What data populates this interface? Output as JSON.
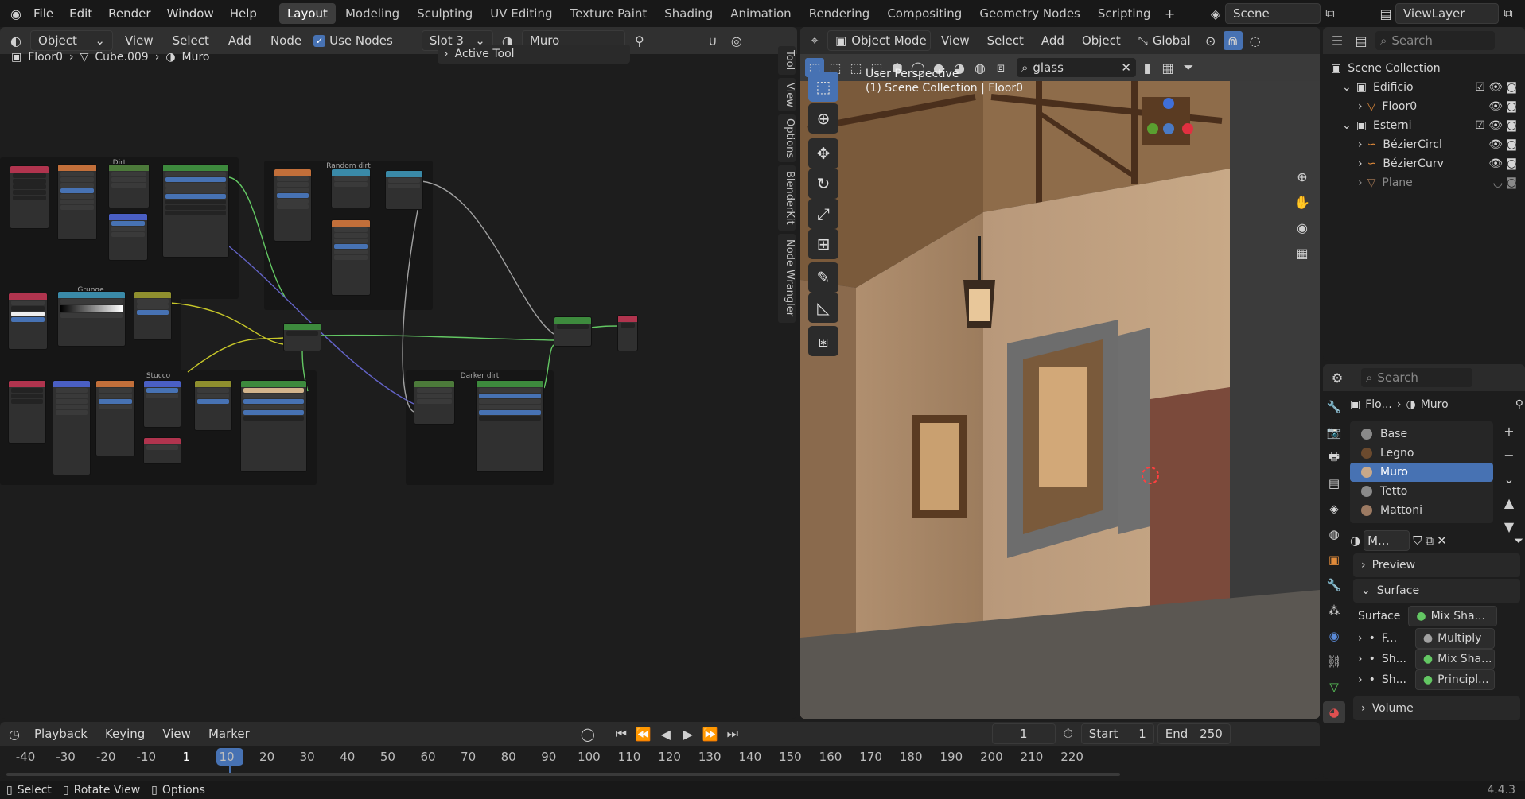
{
  "topbar": {
    "menus": [
      "File",
      "Edit",
      "Render",
      "Window",
      "Help"
    ],
    "workspaces": [
      "Layout",
      "Modeling",
      "Sculpting",
      "UV Editing",
      "Texture Paint",
      "Shading",
      "Animation",
      "Rendering",
      "Compositing",
      "Geometry Nodes",
      "Scripting"
    ],
    "active_workspace": "Layout",
    "scene": "Scene",
    "view_layer": "ViewLayer"
  },
  "node_editor": {
    "object_dropdown": "Object",
    "menus": [
      "View",
      "Select",
      "Add",
      "Node"
    ],
    "use_nodes_label": "Use Nodes",
    "slot": "Slot 3",
    "material": "Muro",
    "breadcrumb": [
      "Floor0",
      "Cube.009",
      "Muro"
    ],
    "active_tool_label": "Active Tool",
    "side_tabs": [
      "Tool",
      "View",
      "Options",
      "BlenderKit",
      "Node Wrangler"
    ],
    "frames": [
      "Dirt",
      "Random dirt",
      "Grunge",
      "Stucco",
      "Darker dirt"
    ]
  },
  "viewport": {
    "mode": "Object Mode",
    "menus": [
      "View",
      "Select",
      "Add",
      "Object"
    ],
    "orientation": "Global",
    "search_value": "glass",
    "overlay_line1": "User Perspective",
    "overlay_line2": "(1) Scene Collection | Floor0"
  },
  "outliner": {
    "search_placeholder": "Search",
    "items": [
      {
        "label": "Scene Collection",
        "level": 0
      },
      {
        "label": "Edificio",
        "level": 1
      },
      {
        "label": "Floor0",
        "level": 2
      },
      {
        "label": "Esterni",
        "level": 1
      },
      {
        "label": "BézierCircl",
        "level": 2
      },
      {
        "label": "BézierCurv",
        "level": 2
      },
      {
        "label": "Plane",
        "level": 2
      }
    ]
  },
  "properties": {
    "search_placeholder": "Search",
    "breadcrumb_obj": "Flo...",
    "breadcrumb_mat": "Muro",
    "slots": [
      {
        "name": "Base",
        "color": "#8a8a8a"
      },
      {
        "name": "Legno",
        "color": "#6b4a2e"
      },
      {
        "name": "Muro",
        "color": "#c9a98a"
      },
      {
        "name": "Tetto",
        "color": "#8a8a8a"
      },
      {
        "name": "Mattoni",
        "color": "#9c7a62"
      }
    ],
    "active_slot": "Muro",
    "material_short": "M...",
    "panels": [
      "Preview",
      "Surface",
      "Volume"
    ],
    "surface_label": "Surface",
    "surface_value": "Mix Sha...",
    "inputs": [
      {
        "label": "F...",
        "value": "Multiply"
      },
      {
        "label": "Sh...",
        "value": "Mix Sha..."
      },
      {
        "label": "Sh...",
        "value": "Principl..."
      }
    ]
  },
  "timeline": {
    "menus": [
      "Playback",
      "Keying",
      "View",
      "Marker"
    ],
    "current_frame": "1",
    "start_label": "Start",
    "start": "1",
    "end_label": "End",
    "end": "250",
    "ticks": [
      "-40",
      "-30",
      "-20",
      "-10",
      "1",
      "10",
      "20",
      "30",
      "40",
      "50",
      "60",
      "70",
      "80",
      "90",
      "100",
      "110",
      "120",
      "130",
      "140",
      "150",
      "160",
      "170",
      "180",
      "190",
      "200",
      "210",
      "220"
    ]
  },
  "statusbar": {
    "items": [
      "Select",
      "Rotate View",
      "Options"
    ],
    "version": "4.4.3"
  }
}
